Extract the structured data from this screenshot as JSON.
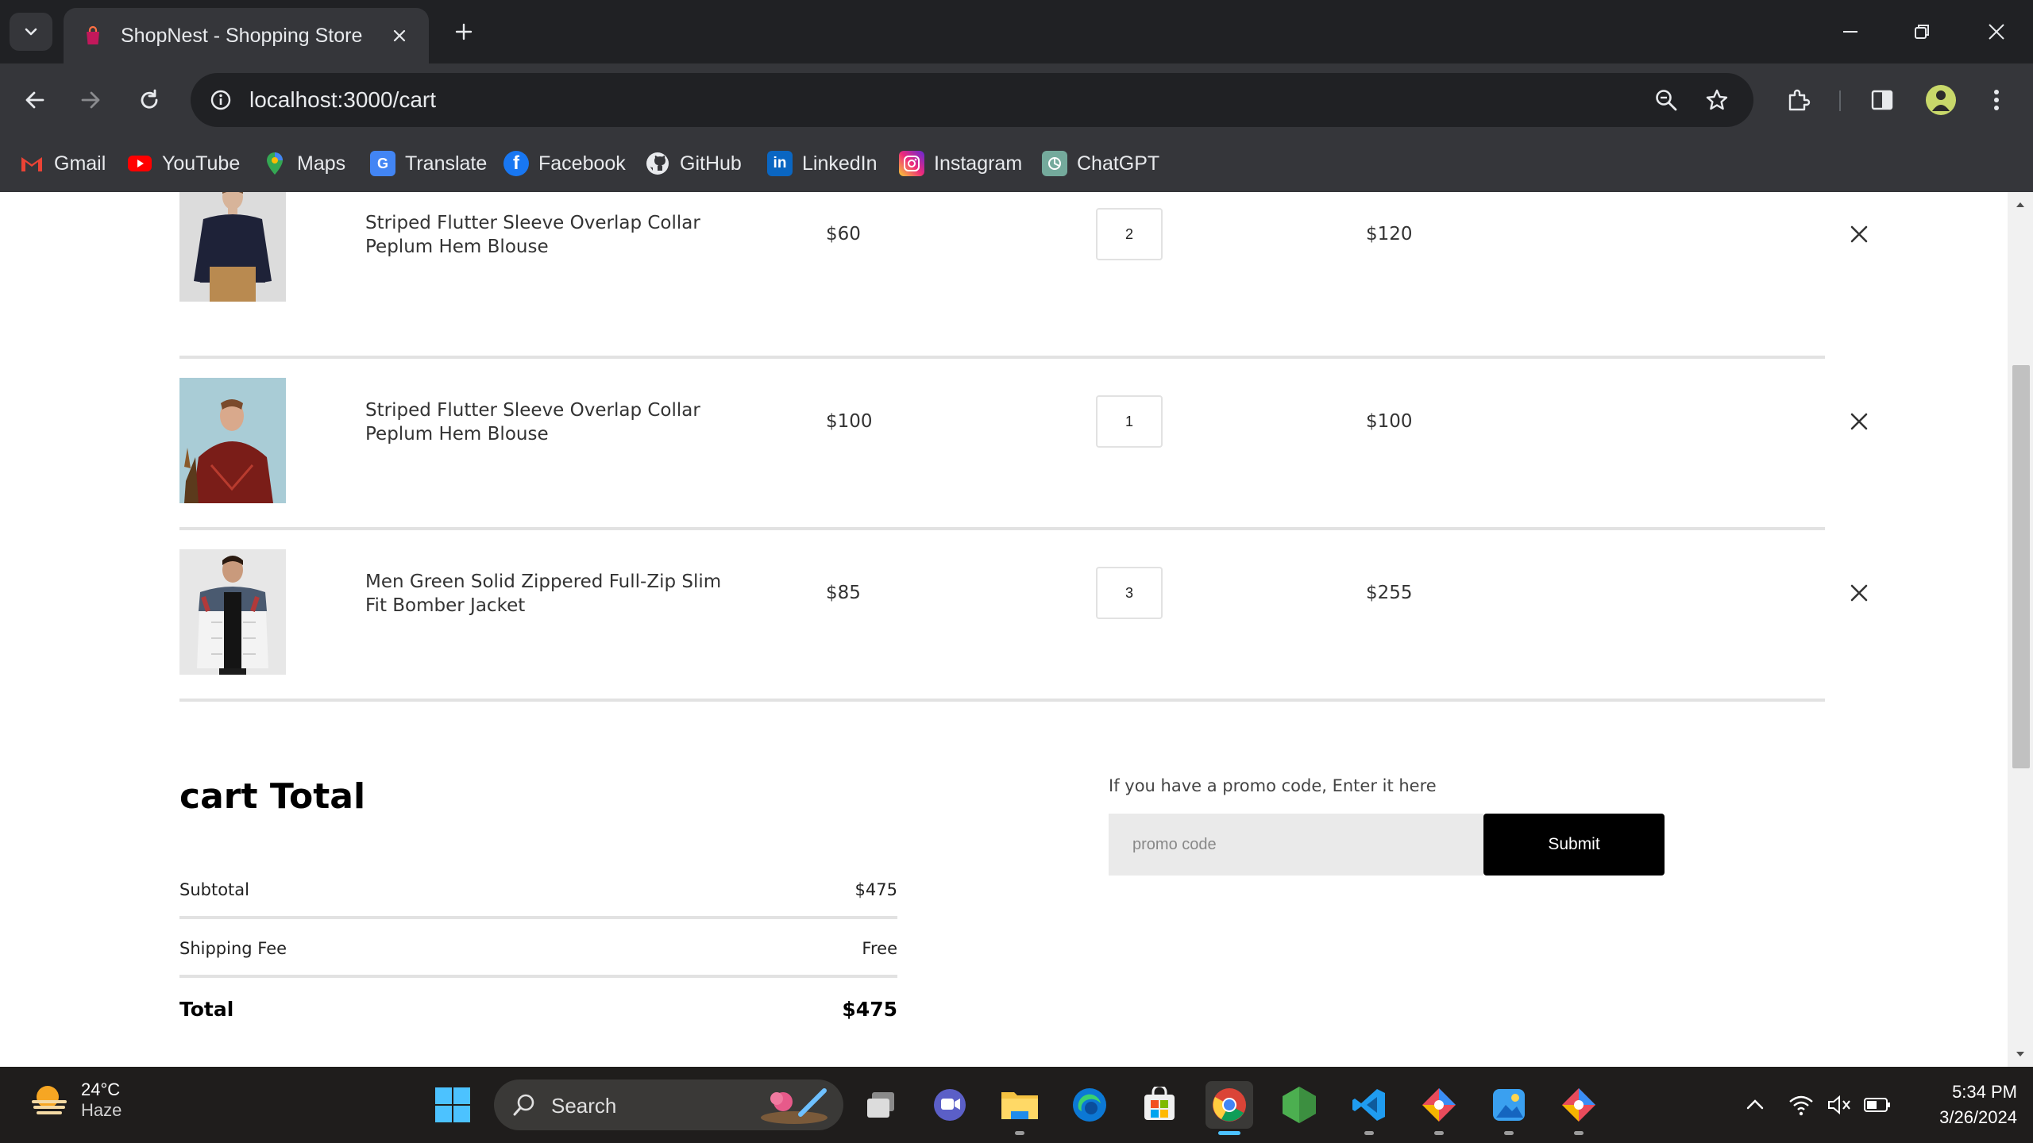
{
  "browser": {
    "tab_title": "ShopNest - Shopping Store",
    "url": "localhost:3000/cart",
    "bookmarks": [
      {
        "label": "Gmail",
        "icon": "gmail-icon"
      },
      {
        "label": "YouTube",
        "icon": "youtube-icon"
      },
      {
        "label": "Maps",
        "icon": "maps-icon"
      },
      {
        "label": "Translate",
        "icon": "translate-icon"
      },
      {
        "label": "Facebook",
        "icon": "facebook-icon"
      },
      {
        "label": "GitHub",
        "icon": "github-icon"
      },
      {
        "label": "LinkedIn",
        "icon": "linkedin-icon"
      },
      {
        "label": "Instagram",
        "icon": "instagram-icon"
      },
      {
        "label": "ChatGPT",
        "icon": "chatgpt-icon"
      }
    ]
  },
  "cart": {
    "items": [
      {
        "name": "Striped Flutter Sleeve Overlap Collar Peplum Hem Blouse",
        "price": "$60",
        "quantity": "2",
        "total": "$120"
      },
      {
        "name": "Striped Flutter Sleeve Overlap Collar Peplum Hem Blouse",
        "price": "$100",
        "quantity": "1",
        "total": "$100"
      },
      {
        "name": "Men Green Solid Zippered Full-Zip Slim Fit Bomber Jacket",
        "price": "$85",
        "quantity": "3",
        "total": "$255"
      }
    ]
  },
  "totals": {
    "title": "cart Total",
    "subtotal_label": "Subtotal",
    "subtotal_value": "$475",
    "shipping_label": "Shipping Fee",
    "shipping_value": "Free",
    "total_label": "Total",
    "total_value": "$475"
  },
  "promo": {
    "label": "If you have a promo code, Enter it here",
    "placeholder": "promo code",
    "submit_label": "Submit"
  },
  "taskbar": {
    "temperature": "24°C",
    "condition": "Haze",
    "search_label": "Search",
    "time": "5:34 PM",
    "date": "3/26/2024"
  },
  "colors": {
    "chrome_dark": "#202124",
    "chrome_toolbar": "#35363a",
    "submit_bg": "#000000",
    "promo_bg": "#eaeaea",
    "divider": "#e2e2e2",
    "taskbar_bg": "#1f1d1c",
    "active_indicator": "#4cc2ff"
  }
}
